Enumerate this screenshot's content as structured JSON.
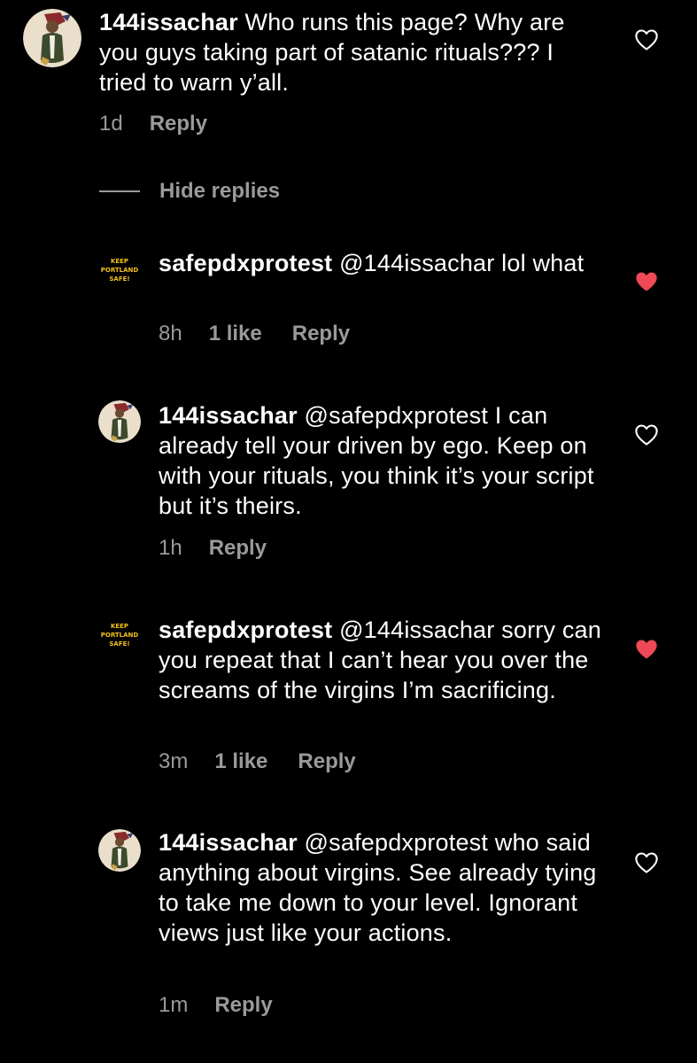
{
  "colors": {
    "background": "#000000",
    "text": "#ffffff",
    "secondary": "#9a9a9a",
    "liked_heart": "#ed4956",
    "logo_yellow": "#f2c21b"
  },
  "parent": {
    "username": "144issachar",
    "body": "Who runs this page? Why are you guys taking part of satanic rituals??? I tried to warn y’all.",
    "time": "1d",
    "reply_label": "Reply",
    "liked": false,
    "avatar_icon": "person-illustration-avatar"
  },
  "hide_replies_label": "Hide replies",
  "logo_text": [
    "KEEP",
    "PORTLAND",
    "SAFE!"
  ],
  "replies": [
    {
      "username": "safepdxprotest",
      "body": "@144issachar lol what",
      "time": "8h",
      "likes": "1 like",
      "reply_label": "Reply",
      "liked": true,
      "avatar_icon": "keep-portland-safe-logo"
    },
    {
      "username": "144issachar",
      "body": "@safepdxprotest I can already tell your driven by ego. Keep on with your rituals, you think it’s your script but it’s theirs.",
      "time": "1h",
      "reply_label": "Reply",
      "liked": false,
      "avatar_icon": "person-illustration-avatar"
    },
    {
      "username": "safepdxprotest",
      "body": "@144issachar sorry can you repeat that I can’t hear you over the screams of the virgins I’m sacrificing.",
      "time": "3m",
      "likes": "1 like",
      "reply_label": "Reply",
      "liked": true,
      "avatar_icon": "keep-portland-safe-logo"
    },
    {
      "username": "144issachar",
      "body": "@safepdxprotest who said anything about virgins. See already tying to take me down to your level. Ignorant views just like your actions.",
      "time": "1m",
      "reply_label": "Reply",
      "liked": false,
      "avatar_icon": "person-illustration-avatar"
    }
  ]
}
